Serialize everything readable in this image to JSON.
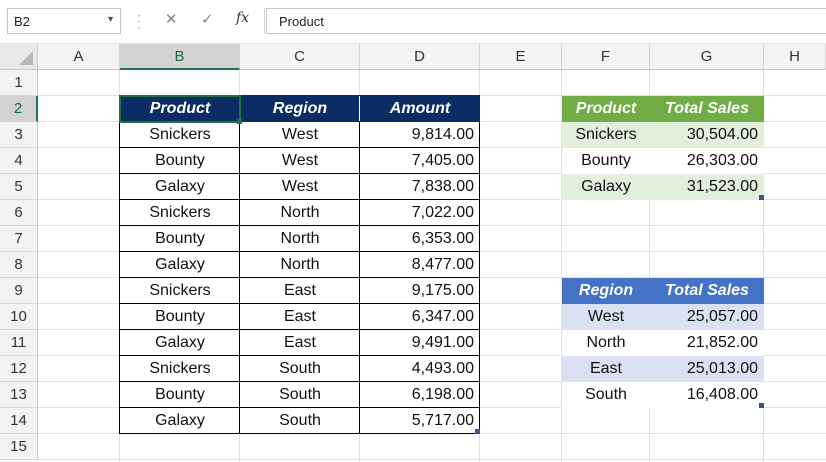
{
  "formula_bar": {
    "name_box": "B2",
    "formula": "Product",
    "cancel_icon": "close-icon",
    "enter_icon": "check-icon",
    "fx_label": "fx"
  },
  "columns": [
    "A",
    "B",
    "C",
    "D",
    "E",
    "F",
    "G",
    "H"
  ],
  "rows": [
    "1",
    "2",
    "3",
    "4",
    "5",
    "6",
    "7",
    "8",
    "9",
    "10",
    "11",
    "12",
    "13",
    "14",
    "15"
  ],
  "selected_cell": "B2",
  "main_table": {
    "headers": [
      "Product",
      "Region",
      "Amount"
    ],
    "header_color": "#0c2c64",
    "rows": [
      [
        "Snickers",
        "West",
        "9,814.00"
      ],
      [
        "Bounty",
        "West",
        "7,405.00"
      ],
      [
        "Galaxy",
        "West",
        "7,838.00"
      ],
      [
        "Snickers",
        "North",
        "7,022.00"
      ],
      [
        "Bounty",
        "North",
        "6,353.00"
      ],
      [
        "Galaxy",
        "North",
        "8,477.00"
      ],
      [
        "Snickers",
        "East",
        "9,175.00"
      ],
      [
        "Bounty",
        "East",
        "6,347.00"
      ],
      [
        "Galaxy",
        "East",
        "9,491.00"
      ],
      [
        "Snickers",
        "South",
        "4,493.00"
      ],
      [
        "Bounty",
        "South",
        "6,198.00"
      ],
      [
        "Galaxy",
        "South",
        "5,717.00"
      ]
    ]
  },
  "product_table": {
    "headers": [
      "Product",
      "Total Sales"
    ],
    "header_color": "#70ad47",
    "band_color": "#e2efda",
    "rows": [
      [
        "Snickers",
        "30,504.00"
      ],
      [
        "Bounty",
        "26,303.00"
      ],
      [
        "Galaxy",
        "31,523.00"
      ]
    ]
  },
  "region_table": {
    "headers": [
      "Region",
      "Total Sales"
    ],
    "header_color": "#4472c4",
    "band_color": "#d9e1f2",
    "rows": [
      [
        "West",
        "25,057.00"
      ],
      [
        "North",
        "21,852.00"
      ],
      [
        "East",
        "25,013.00"
      ],
      [
        "South",
        "16,408.00"
      ]
    ]
  }
}
